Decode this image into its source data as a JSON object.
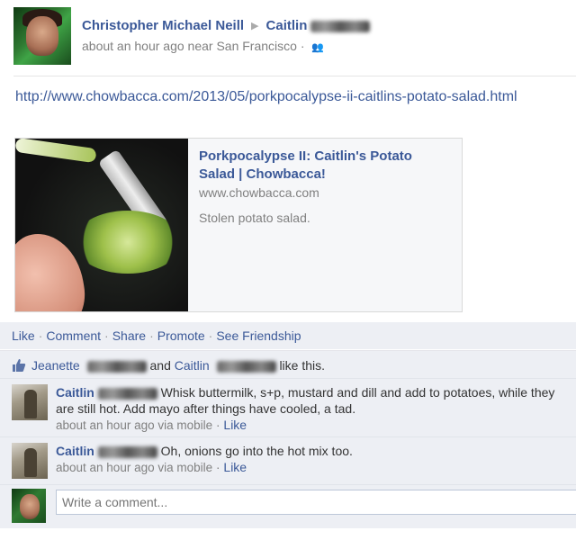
{
  "post": {
    "author": "Christopher Michael Neill",
    "target": "Caitlin",
    "time": "about an hour ago near San Francisco",
    "meta_sep": "·",
    "url": "http://www.chowbacca.com/2013/05/porkpocalypse-ii-caitlins-potato-salad.html"
  },
  "card": {
    "title": "Porkpocalypse II: Caitlin's Potato Salad | Chowbacca!",
    "domain": "www.chowbacca.com",
    "description": "Stolen potato salad."
  },
  "actions": {
    "like": "Like",
    "comment": "Comment",
    "share": "Share",
    "promote": "Promote",
    "see_friendship": "See Friendship",
    "sep": "·"
  },
  "likes": {
    "first": "Jeanette",
    "and": "and",
    "second": "Caitlin",
    "suffix": "like this."
  },
  "comments": [
    {
      "name": "Caitlin",
      "text": "Whisk buttermilk, s+p, mustard and dill and add to potatoes, while they are still hot. Add mayo after things have cooled, a tad.",
      "time": "about an hour ago via mobile",
      "sep": "·",
      "like": "Like"
    },
    {
      "name": "Caitlin",
      "text": "Oh, onions go into the hot mix too.",
      "time": "about an hour ago via mobile",
      "sep": "·",
      "like": "Like"
    }
  ],
  "write": {
    "placeholder": "Write a comment..."
  },
  "colors": {
    "link": "#3b5998",
    "panel": "#edeff4",
    "muted": "#808080"
  },
  "icons": {
    "audience": "friends-audience-icon",
    "like": "thumbs-up-icon"
  }
}
